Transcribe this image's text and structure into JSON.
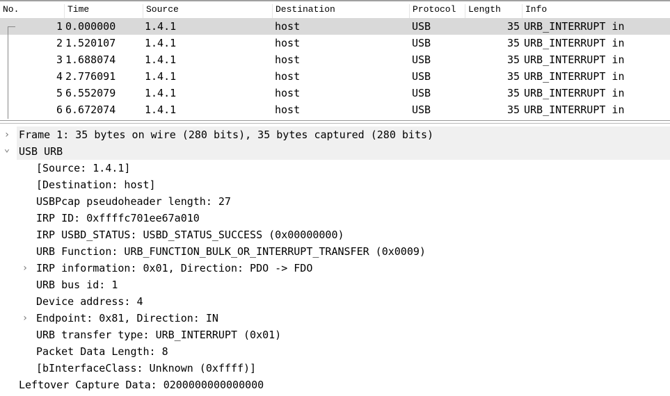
{
  "columns": [
    "No.",
    "Time",
    "Source",
    "Destination",
    "Protocol",
    "Length",
    "Info"
  ],
  "packets": [
    {
      "no": "1",
      "time": "0.000000",
      "src": "1.4.1",
      "dst": "host",
      "proto": "USB",
      "len": "35",
      "info": "URB_INTERRUPT in"
    },
    {
      "no": "2",
      "time": "1.520107",
      "src": "1.4.1",
      "dst": "host",
      "proto": "USB",
      "len": "35",
      "info": "URB_INTERRUPT in"
    },
    {
      "no": "3",
      "time": "1.688074",
      "src": "1.4.1",
      "dst": "host",
      "proto": "USB",
      "len": "35",
      "info": "URB_INTERRUPT in"
    },
    {
      "no": "4",
      "time": "2.776091",
      "src": "1.4.1",
      "dst": "host",
      "proto": "USB",
      "len": "35",
      "info": "URB_INTERRUPT in"
    },
    {
      "no": "5",
      "time": "6.552079",
      "src": "1.4.1",
      "dst": "host",
      "proto": "USB",
      "len": "35",
      "info": "URB_INTERRUPT in"
    },
    {
      "no": "6",
      "time": "6.672074",
      "src": "1.4.1",
      "dst": "host",
      "proto": "USB",
      "len": "35",
      "info": "URB_INTERRUPT in"
    }
  ],
  "details": [
    "Frame 1: 35 bytes on wire (280 bits), 35 bytes captured (280 bits)",
    "USB URB",
    "[Source: 1.4.1]",
    "[Destination: host]",
    "USBPcap pseudoheader length: 27",
    "IRP ID: 0xffffc701ee67a010",
    "IRP USBD_STATUS: USBD_STATUS_SUCCESS (0x00000000)",
    "URB Function: URB_FUNCTION_BULK_OR_INTERRUPT_TRANSFER (0x0009)",
    "IRP information: 0x01, Direction: PDO -> FDO",
    "URB bus id: 1",
    "Device address: 4",
    "Endpoint: 0x81, Direction: IN",
    "URB transfer type: URB_INTERRUPT (0x01)",
    "Packet Data Length: 8",
    "[bInterfaceClass: Unknown (0xffff)]",
    "Leftover Capture Data: 0200000000000000"
  ]
}
